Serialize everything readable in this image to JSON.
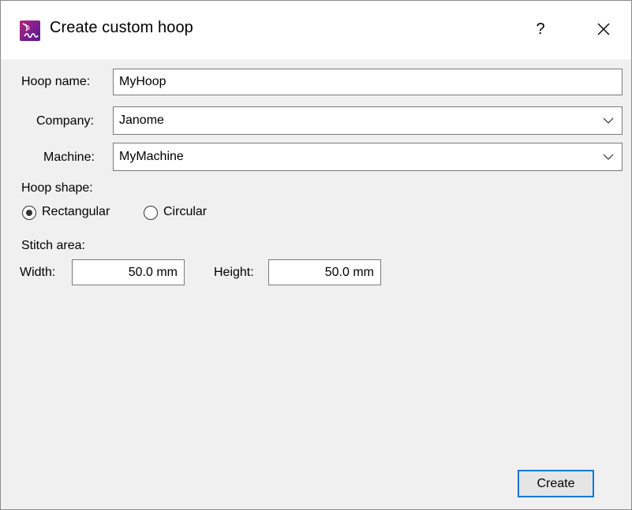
{
  "window": {
    "title": "Create custom hoop",
    "help_label": "?",
    "app_icon": "embroidery-app-icon",
    "close_icon": "close-icon"
  },
  "form": {
    "hoop_name_label": "Hoop name:",
    "hoop_name_value": "MyHoop",
    "company_label": "Company:",
    "company_value": "Janome",
    "machine_label": "Machine:",
    "machine_value": "MyMachine",
    "hoop_shape_label": "Hoop shape:",
    "shape_options": [
      {
        "label": "Rectangular",
        "selected": true
      },
      {
        "label": "Circular",
        "selected": false
      }
    ],
    "stitch_area_label": "Stitch area:",
    "width_label": "Width:",
    "width_value": "50.0 mm",
    "height_label": "Height:",
    "height_value": "50.0 mm"
  },
  "footer": {
    "create_label": "Create"
  },
  "colors": {
    "dialog_bg": "#f0f0f0",
    "titlebar_bg": "#ffffff",
    "focus_border": "#0078d7",
    "icon_magenta": "#b5267a"
  }
}
